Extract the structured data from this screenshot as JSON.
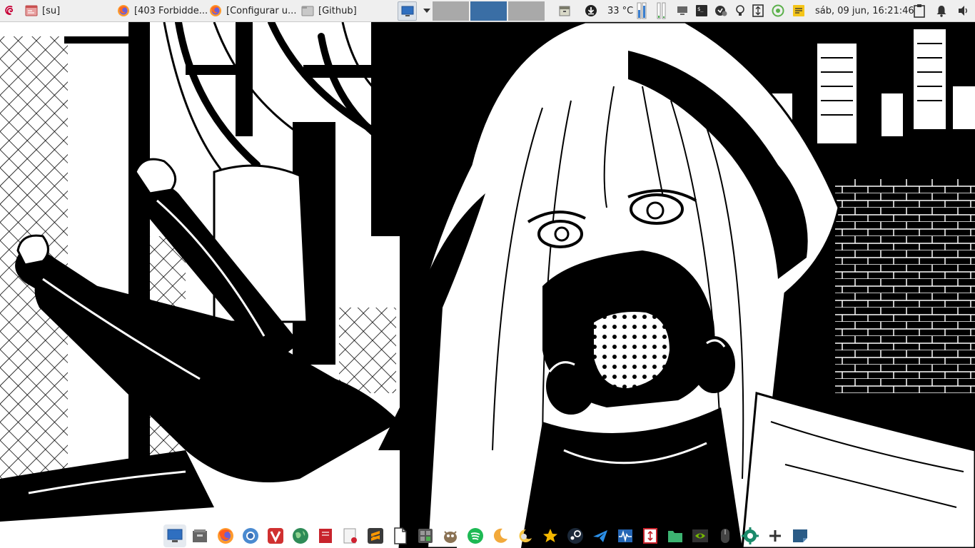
{
  "panel": {
    "tasks": [
      {
        "label": "[su]"
      },
      {
        "label": "[403 Forbidde..."
      },
      {
        "label": "[Configurar u..."
      },
      {
        "label": "[Github]"
      }
    ],
    "temperature": "33 °C",
    "clock": "sáb, 09 jun, 16:21:46",
    "colors": {
      "panel_bg": "#efefef",
      "workspace_active": "#3a6ea5",
      "workspace_inactive": "#a9a9a9"
    }
  },
  "icons": {
    "debian": "debian-swirl-icon",
    "terminal_task": "terminal-task-icon",
    "firefox": "firefox-icon",
    "folder": "folder-task-icon"
  },
  "dock": {
    "items": [
      "desktop",
      "file-manager",
      "firefox",
      "chromium",
      "vivaldi",
      "earth",
      "rednotebook",
      "text-editor",
      "sublime-text",
      "document",
      "calculator",
      "gimp",
      "spotify",
      "moon",
      "weather",
      "bookmarks",
      "steam",
      "telegram",
      "system-monitor",
      "password-manager",
      "folder",
      "nvidia-settings",
      "mouse",
      "settings",
      "terminal",
      "sticky-notes"
    ]
  }
}
